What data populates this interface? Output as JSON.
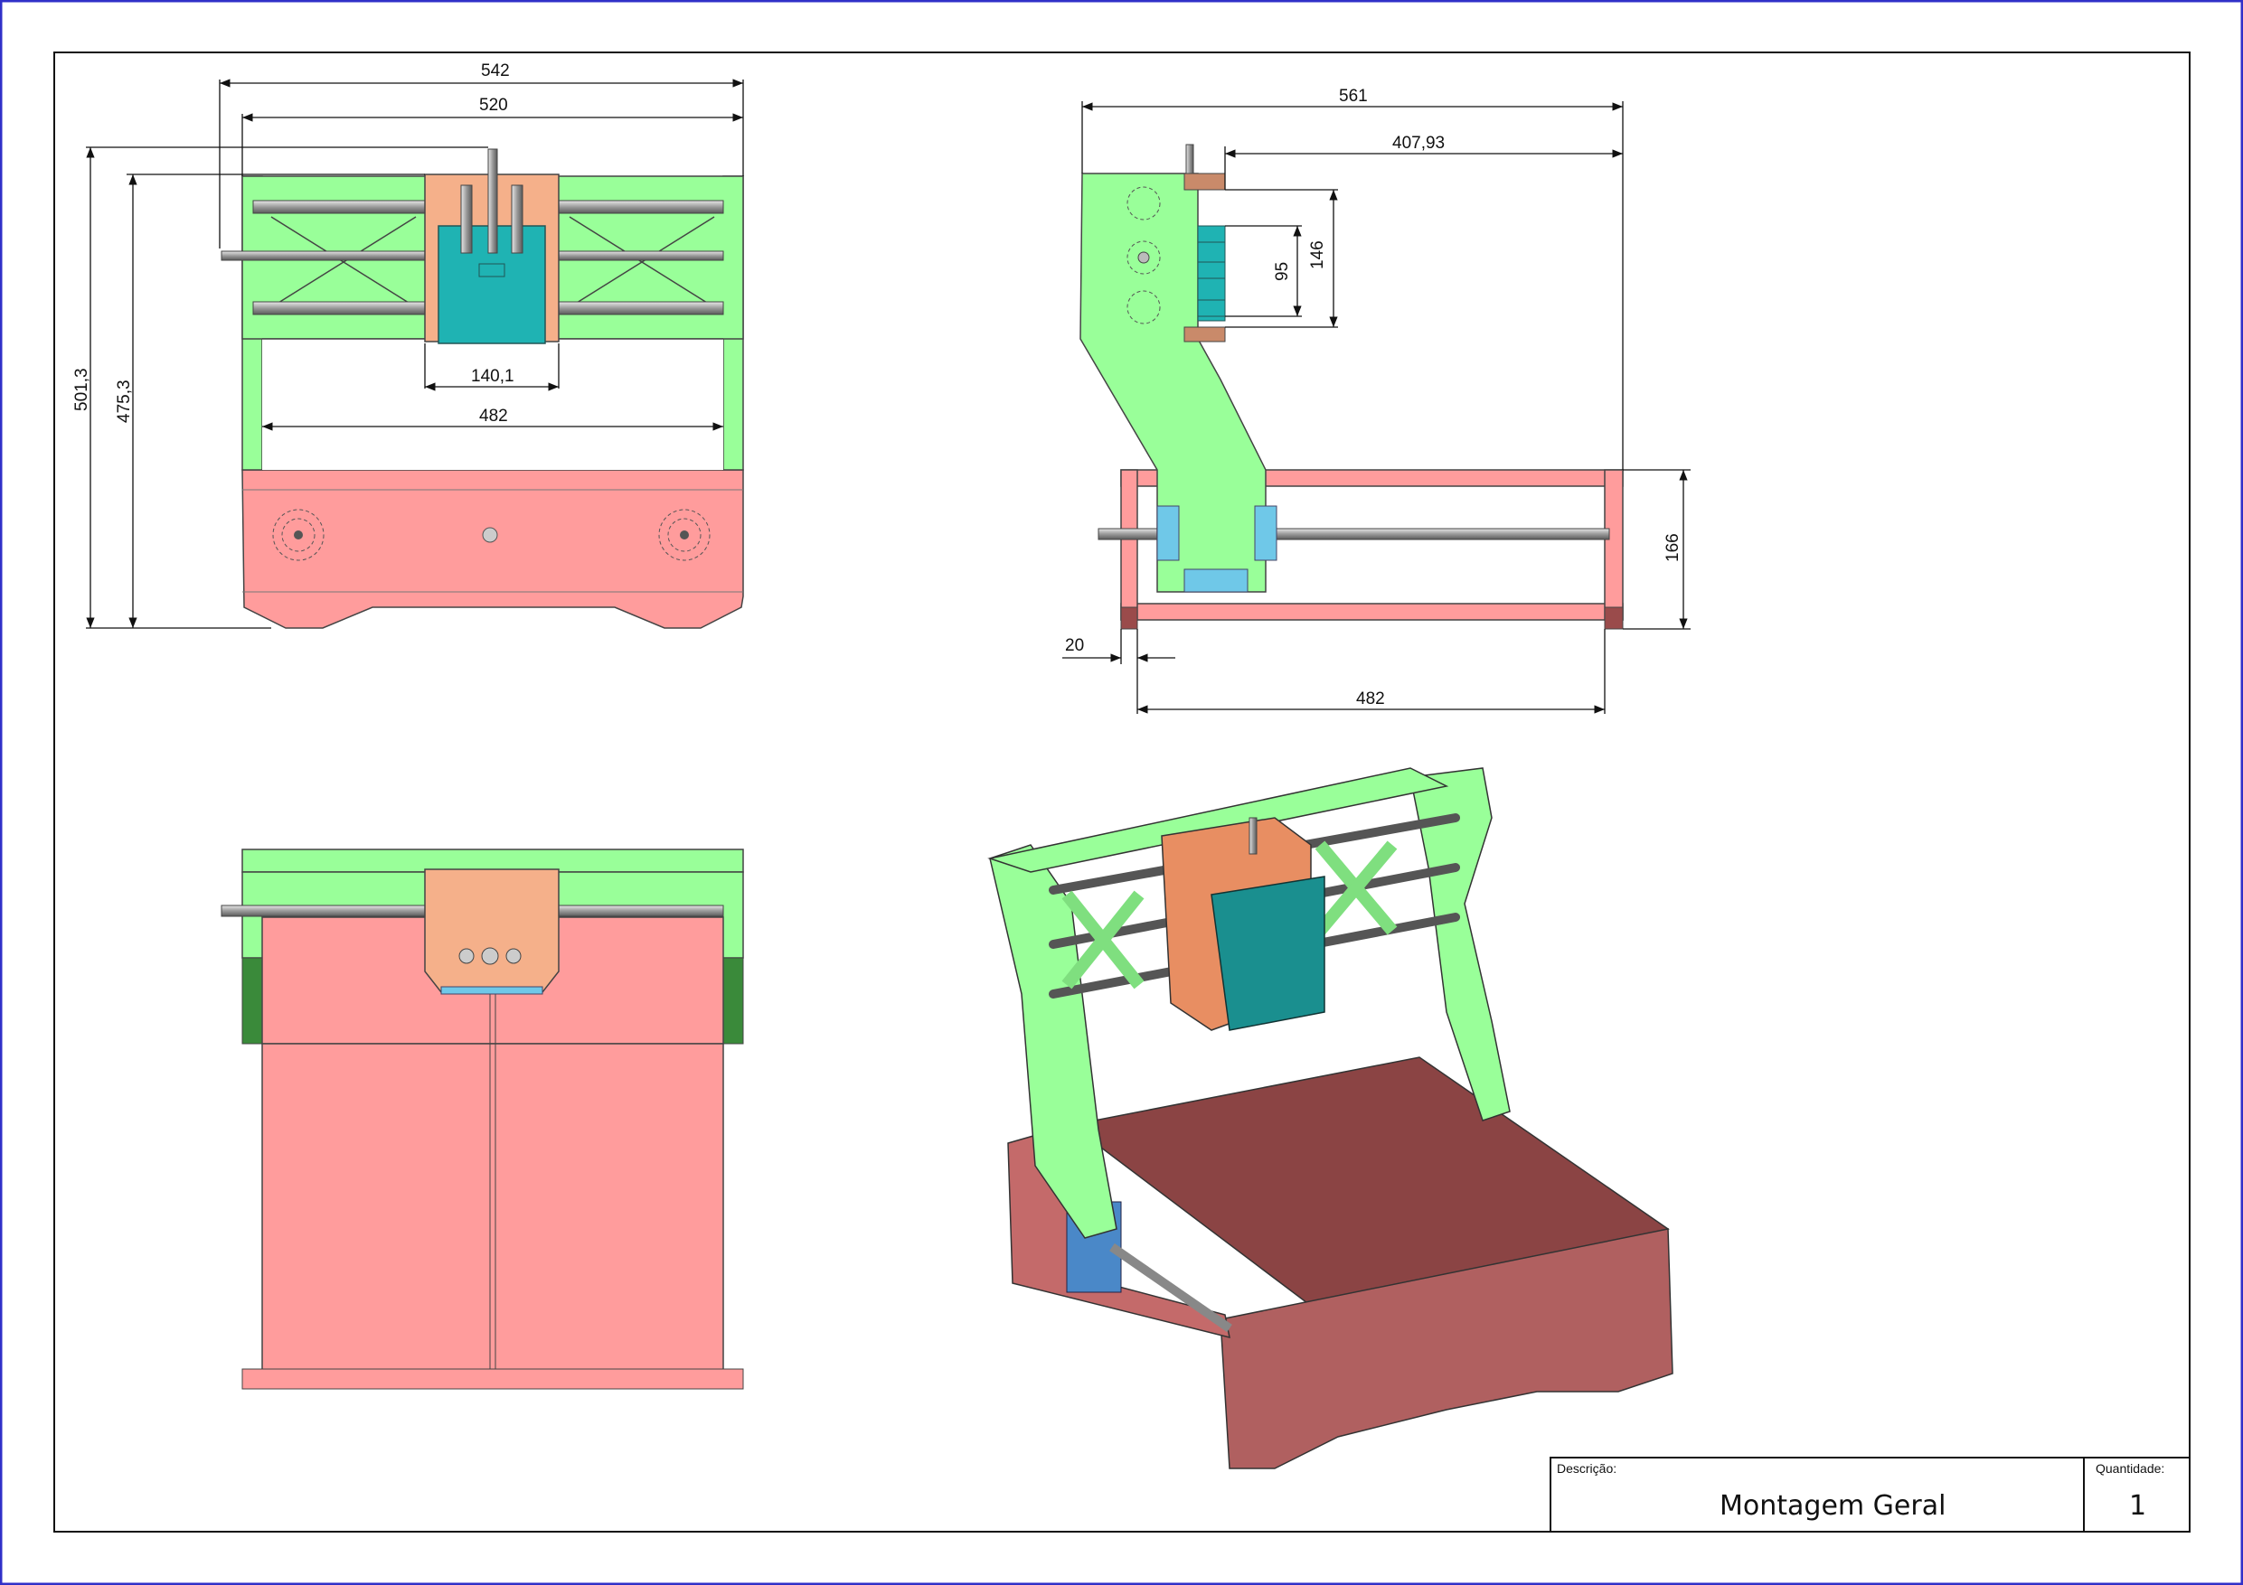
{
  "colors": {
    "frame_green": "#99ff99",
    "frame_green_dark": "#3a8a3a",
    "bed_pink": "#ff9c9c",
    "carriage_orange": "#f5b08a",
    "spindle_teal": "#1fb3b3",
    "bearing_blue": "#6fc8e8",
    "bed_3d": "#8b4444",
    "border_blue": "#3030c8"
  },
  "views": {
    "front": {
      "dims": {
        "overall_width": "542",
        "frame_width": "520",
        "carriage_width": "140,1",
        "inner_width": "482",
        "height_total": "501,3",
        "height_frame": "475,3"
      }
    },
    "side": {
      "dims": {
        "depth_total": "561",
        "depth_gantry": "407,93",
        "z_travel": "146",
        "z_spacing": "95",
        "base_height": "166",
        "offset": "20",
        "inner_length": "482"
      }
    }
  },
  "title_block": {
    "description_label": "Descrição:",
    "description_value": "Montagem Geral",
    "quantity_label": "Quantidade:",
    "quantity_value": "1"
  }
}
